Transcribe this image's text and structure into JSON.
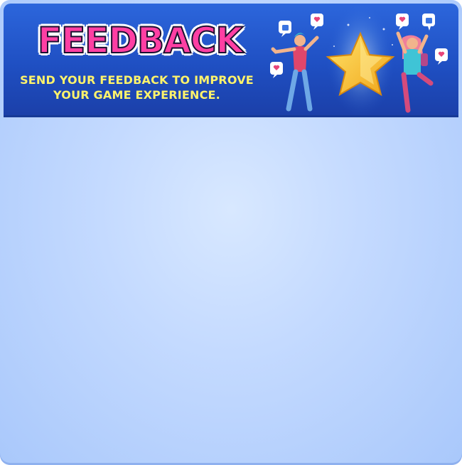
{
  "banner": {
    "title": "FEEDBACK",
    "subtitle_line1": "SEND YOUR FEEDBACK TO IMPROVE",
    "subtitle_line2": "YOUR GAME EXPERIENCE.",
    "illustration": "people-celebrating-star-illustration"
  },
  "colors": {
    "banner_blue": "#1f4fc2",
    "title_pink": "#ff3fa3",
    "subtitle_yellow": "#fff36b",
    "panel_background": "#c4daff"
  }
}
